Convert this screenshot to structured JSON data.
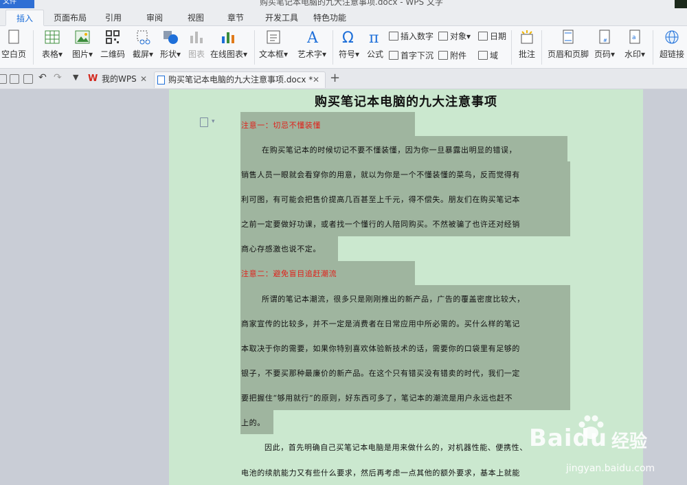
{
  "app": {
    "menu_button": "文件",
    "window_title": "购买笔记本电脑的九大注意事项.docx - WPS 文字"
  },
  "ribbon_tabs": [
    {
      "label": "插入",
      "active": true
    },
    {
      "label": "页面布局"
    },
    {
      "label": "引用"
    },
    {
      "label": "审阅"
    },
    {
      "label": "视图"
    },
    {
      "label": "章节"
    },
    {
      "label": "开发工具"
    },
    {
      "label": "特色功能"
    }
  ],
  "ribbon": {
    "blank_page": "空白页",
    "table": "表格",
    "picture": "图片",
    "qrcode": "二维码",
    "screenshot": "截屏",
    "shapes": "形状",
    "chart": "图表",
    "online_chart": "在线图表",
    "textbox": "文本框",
    "wordart": "艺术字",
    "symbol": "符号",
    "formula": "公式",
    "insert_number": "插入数字",
    "object": "对象",
    "date": "日期",
    "dropcap": "首字下沉",
    "attachment": "附件",
    "field": "域",
    "comment": "批注",
    "header_footer": "页眉和页脚",
    "page_number": "页码",
    "watermark": "水印",
    "hyperlink": "超链接"
  },
  "doc_tabs": [
    {
      "label": "我的WPS",
      "active": false
    },
    {
      "label": "购买笔记本电脑的九大注意事项.docx *",
      "active": true
    }
  ],
  "document": {
    "title": "购买笔记本电脑的九大注意事项",
    "heading1": "注意一：切忌不懂装懂",
    "para1": [
      "在购买笔记本的时候切记不要不懂装懂，因为你一旦暴露出明显的错误，",
      "销售人员一眼就会看穿你的用意，就以为你是一个不懂装懂的菜鸟，反而觉得有",
      "利可图，有可能会把售价提高几百甚至上千元，得不偿失。朋友们在购买笔记本",
      "之前一定要做好功课，或者找一个懂行的人陪同购买。不然被骗了也许还对经销",
      "商心存感激也说不定。"
    ],
    "heading2": "注意二：避免盲目追赶潮流",
    "para2": [
      "所谓的笔记本潮流，很多只是刚刚推出的新产品，广告的覆盖密度比较大，",
      "商家宣传的比较多，并不一定是消费者在日常应用中所必需的。买什么样的笔记",
      "本取决于你的需要，如果你特别喜欢体验新技术的话，需要你的口袋里有足够的",
      "银子，不要买那种最廉价的新产品。在这个只有错买没有错卖的时代，我们一定",
      "要把握住“够用就行”的原则，好东西可多了，笔记本的潮流是用户永远也赶不",
      "上的。"
    ],
    "para3": [
      "因此，首先明确自己买笔记本电脑是用来做什么的，对机器性能、便携性、",
      "电池的续航能力又有些什么要求，然后再考虑一点其他的额外要求，基本上就能"
    ]
  },
  "watermark": {
    "brand": "Baidu",
    "brand_cn": "经验",
    "url": "jingyan.baidu.com"
  },
  "colors": {
    "accent": "#1e6fd9",
    "page_bg": "#cbe8cf",
    "selection": "#9fb59f",
    "heading_red": "#e0201a"
  }
}
